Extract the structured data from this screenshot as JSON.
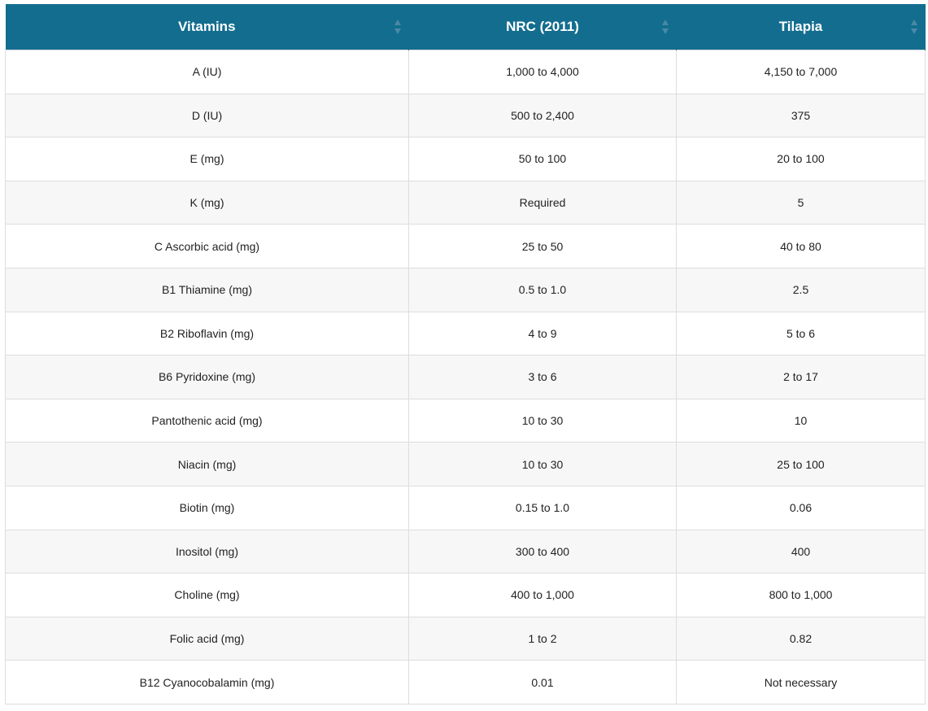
{
  "colors": {
    "header_bg": "#136d8f",
    "header_text": "#ffffff",
    "row_alt": "#f7f7f7",
    "border": "#dddddd"
  },
  "table": {
    "headers": [
      {
        "label": "Vitamins",
        "icon": "sort-icon"
      },
      {
        "label": "NRC (2011)",
        "icon": "sort-icon"
      },
      {
        "label": "Tilapia",
        "icon": "sort-icon"
      }
    ],
    "rows": [
      [
        "A (IU)",
        "1,000 to 4,000",
        "4,150 to 7,000"
      ],
      [
        "D (IU)",
        "500 to 2,400",
        "375"
      ],
      [
        "E (mg)",
        "50 to 100",
        "20 to 100"
      ],
      [
        "K (mg)",
        "Required",
        "5"
      ],
      [
        "C Ascorbic acid (mg)",
        "25 to 50",
        "40 to 80"
      ],
      [
        "B1 Thiamine (mg)",
        "0.5 to 1.0",
        "2.5"
      ],
      [
        "B2 Riboflavin (mg)",
        "4 to 9",
        "5 to 6"
      ],
      [
        "B6 Pyridoxine (mg)",
        "3 to 6",
        "2 to 17"
      ],
      [
        "Pantothenic acid (mg)",
        "10 to 30",
        "10"
      ],
      [
        "Niacin (mg)",
        "10 to 30",
        "25 to 100"
      ],
      [
        "Biotin (mg)",
        "0.15 to 1.0",
        "0.06"
      ],
      [
        "Inositol (mg)",
        "300 to 400",
        "400"
      ],
      [
        "Choline (mg)",
        "400 to 1,000",
        "800 to 1,000"
      ],
      [
        "Folic acid (mg)",
        "1 to 2",
        "0.82"
      ],
      [
        "B12 Cyanocobalamin (mg)",
        "0.01",
        "Not necessary"
      ]
    ]
  }
}
